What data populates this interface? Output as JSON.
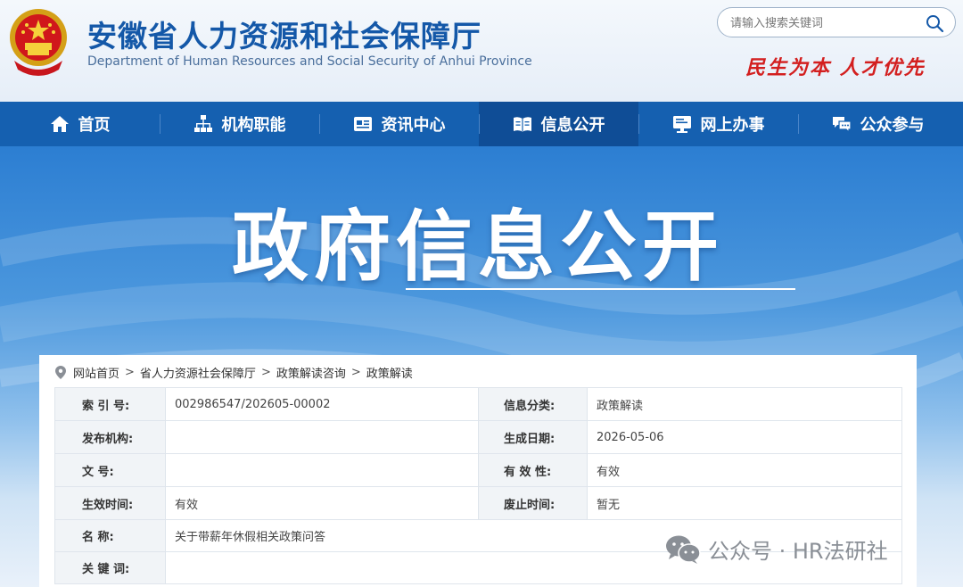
{
  "header": {
    "title_cn": "安徽省人力资源和社会保障厅",
    "title_en": "Department of Human Resources and Social Security of Anhui Province",
    "slogan": "民生为本 人才优先",
    "search_placeholder": "请输入搜索关键词"
  },
  "nav": {
    "items": [
      {
        "label": "首页",
        "icon": "home-icon"
      },
      {
        "label": "机构职能",
        "icon": "org-chart-icon"
      },
      {
        "label": "资讯中心",
        "icon": "news-card-icon"
      },
      {
        "label": "信息公开",
        "icon": "open-book-icon",
        "active": true
      },
      {
        "label": "网上办事",
        "icon": "monitor-icon"
      },
      {
        "label": "公众参与",
        "icon": "chat-bubbles-icon"
      }
    ]
  },
  "banner": {
    "title": "政府信息公开"
  },
  "breadcrumb": [
    "网站首页",
    "省人力资源社会保障厅",
    "政策解读咨询",
    "政策解读"
  ],
  "info_table": {
    "rows": [
      {
        "l_label": "索 引 号:",
        "l_value": "002986547/202605-00002",
        "r_label": "信息分类:",
        "r_value": "政策解读"
      },
      {
        "l_label": "发布机构:",
        "l_value": "",
        "r_label": "生成日期:",
        "r_value": "2026-05-06"
      },
      {
        "l_label": "文 号:",
        "l_value": "",
        "r_label": "有 效 性:",
        "r_value": "有效"
      },
      {
        "l_label": "生效时间:",
        "l_value": "有效",
        "r_label": "废止时间:",
        "r_value": "暂无"
      },
      {
        "l_label": "名 称:",
        "l_value": "关于带薪年休假相关政策问答"
      },
      {
        "l_label": "关 键 词:",
        "l_value": ""
      }
    ]
  },
  "watermark": {
    "text": "公众号 · HR法研社"
  },
  "colors": {
    "brand_blue": "#1458a8",
    "nav_blue": "#1560b0",
    "nav_active": "#0f4d96",
    "slogan_red": "#d31f1f"
  }
}
